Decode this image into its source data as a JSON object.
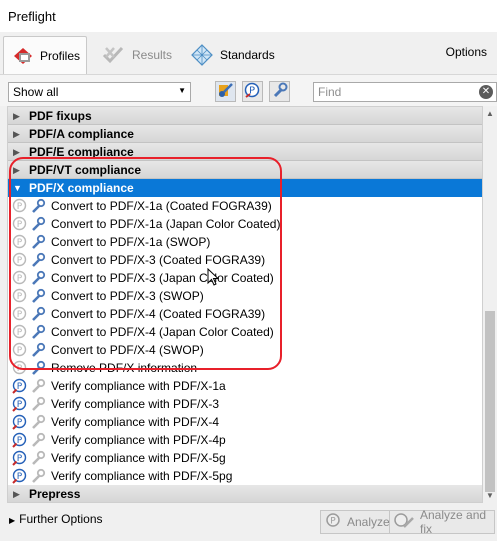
{
  "window": {
    "title": "Preflight"
  },
  "tabs": [
    {
      "label": "Profiles",
      "icon": "profiles-icon",
      "active": true
    },
    {
      "label": "Results",
      "icon": "results-icon",
      "active": false
    },
    {
      "label": "Standards",
      "icon": "standards-icon",
      "active": false
    }
  ],
  "header": {
    "options_label": "Options"
  },
  "toolbar": {
    "filter_selected": "Show all",
    "search_placeholder": "Find",
    "search_value": ""
  },
  "categories": {
    "fixups": "PDF fixups",
    "pdfa": "PDF/A compliance",
    "pdfe": "PDF/E compliance",
    "pdfvt": "PDF/VT compliance",
    "pdfx": "PDF/X compliance",
    "prepress": "Prepress"
  },
  "pdfx_items": [
    "Convert to PDF/X-1a (Coated FOGRA39)",
    "Convert to PDF/X-1a (Japan Color Coated)",
    "Convert to PDF/X-1a (SWOP)",
    "Convert to PDF/X-3 (Coated FOGRA39)",
    "Convert to PDF/X-3 (Japan Color Coated)",
    "Convert to PDF/X-3 (SWOP)",
    "Convert to PDF/X-4 (Coated FOGRA39)",
    "Convert to PDF/X-4 (Japan Color Coated)",
    "Convert to PDF/X-4 (SWOP)",
    "Remove PDF/X information",
    "Verify compliance with PDF/X-1a",
    "Verify compliance with PDF/X-3",
    "Verify compliance with PDF/X-4",
    "Verify compliance with PDF/X-4p",
    "Verify compliance with PDF/X-5g",
    "Verify compliance with PDF/X-5pg"
  ],
  "footer": {
    "further_options": "Further Options",
    "analyze": "Analyze",
    "analyze_fix": "Analyze and fix"
  },
  "colors": {
    "selection": "#0a78d7",
    "annotation": "#e8202a"
  }
}
